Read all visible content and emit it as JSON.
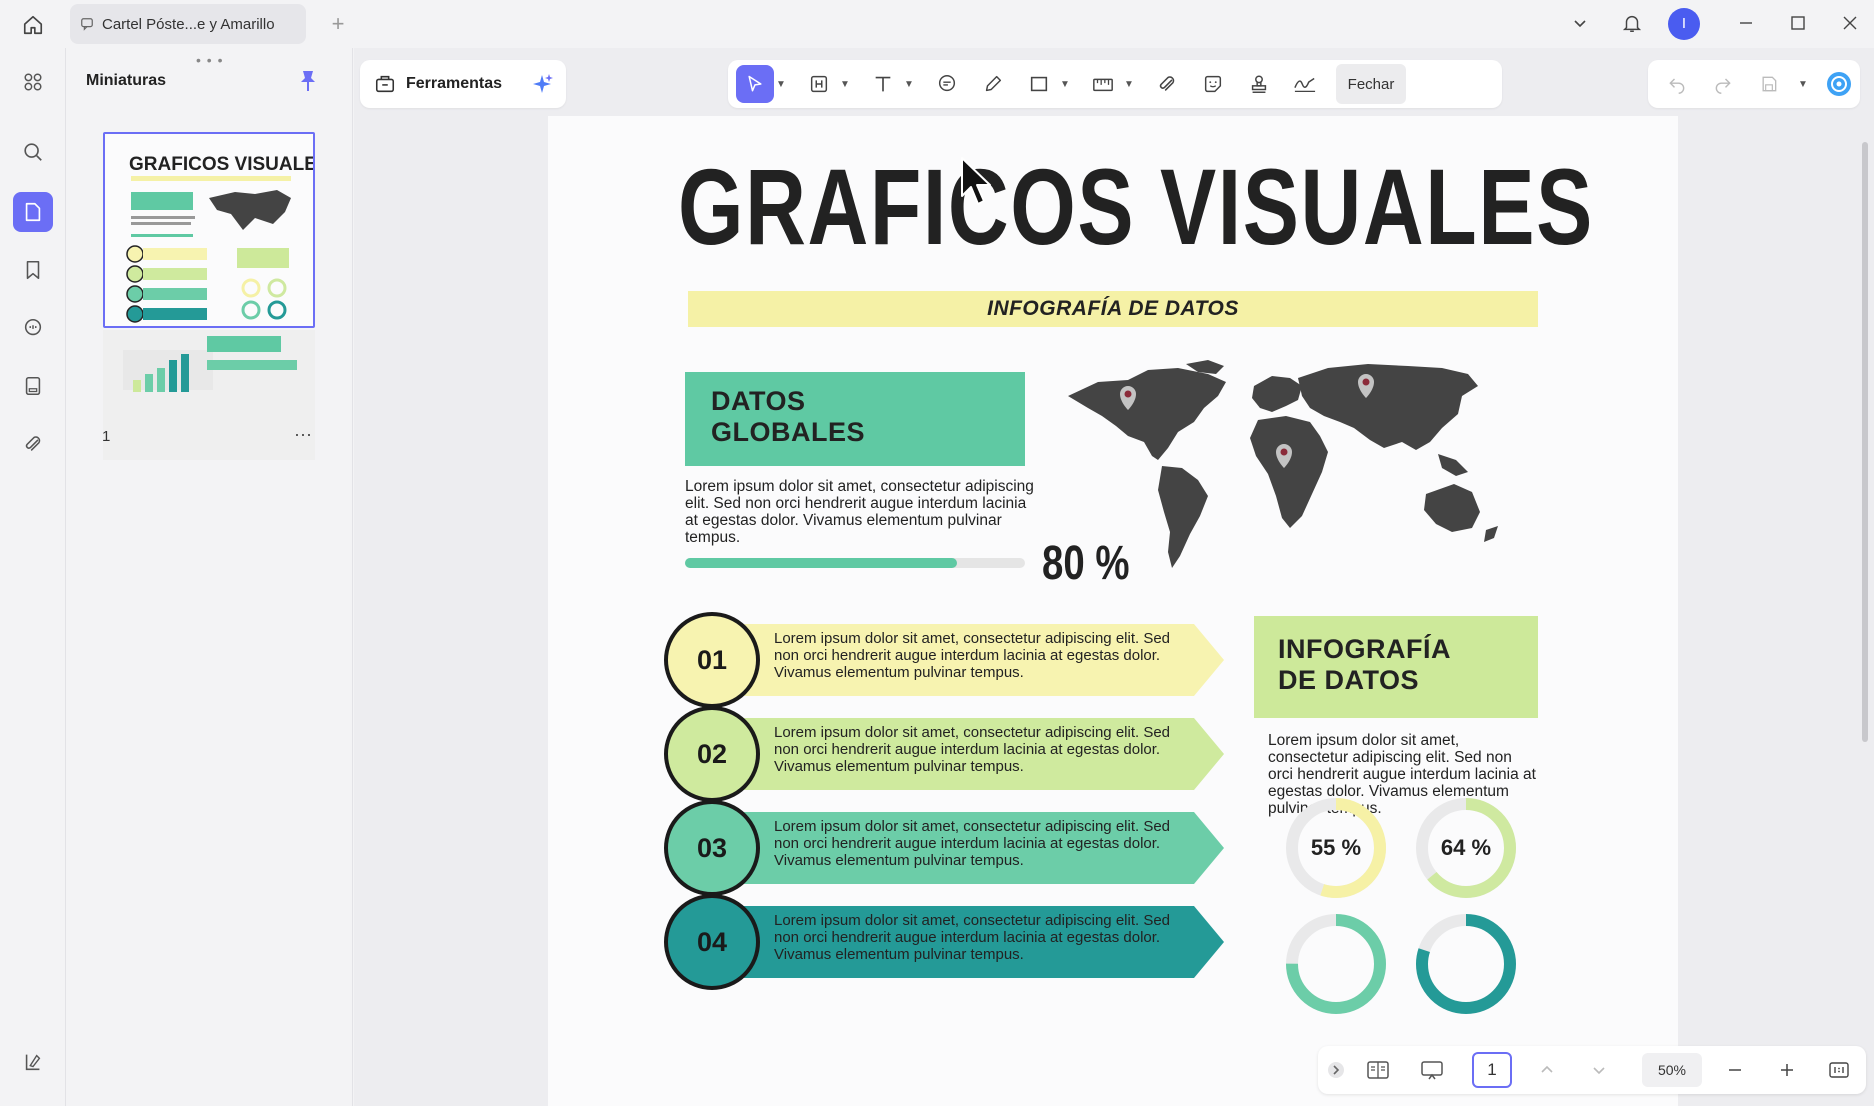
{
  "app": {
    "tab_title": "Cartel Póste...e y Amarillo",
    "avatar_initial": "I"
  },
  "sidebar": {
    "panel_title": "Miniaturas",
    "page_number": "1",
    "more": "···"
  },
  "toolbar": {
    "tools_label": "Ferramentas",
    "close_label": "Fechar"
  },
  "document": {
    "title": "GRAFICOS VISUALES",
    "subtitle": "INFOGRAFÍA DE DATOS",
    "global": {
      "heading_line1": "DATOS",
      "heading_line2": "GLOBALES",
      "body": "Lorem ipsum dolor sit amet, consectetur adipiscing elit. Sed non orci hendrerit augue interdum lacinia at egestas dolor. Vivamus elementum pulvinar tempus.",
      "percent_label": "80 %",
      "progress": 0.8
    },
    "steps": [
      {
        "num": "01",
        "text": "Lorem ipsum dolor sit amet, consectetur adipiscing elit. Sed non orci hendrerit augue interdum lacinia at egestas dolor. Vivamus elementum pulvinar tempus.",
        "color": "#f7f3b0"
      },
      {
        "num": "02",
        "text": "Lorem ipsum dolor sit amet, consectetur adipiscing elit. Sed non orci hendrerit augue interdum lacinia at egestas dolor. Vivamus elementum pulvinar tempus.",
        "color": "#cfea9e"
      },
      {
        "num": "03",
        "text": "Lorem ipsum dolor sit amet, consectetur adipiscing elit. Sed non orci hendrerit augue interdum lacinia at egestas dolor. Vivamus elementum pulvinar tempus.",
        "color": "#6ccda8"
      },
      {
        "num": "04",
        "text": "Lorem ipsum dolor sit amet, consectetur adipiscing elit. Sed non orci hendrerit augue interdum lacinia at egestas dolor. Vivamus elementum pulvinar tempus.",
        "color": "#249a97"
      }
    ],
    "info": {
      "heading_line1": "INFOGRAFÍA",
      "heading_line2": "DE DATOS",
      "body": "Lorem ipsum dolor sit amet, consectetur adipiscing elit. Sed non orci hendrerit augue interdum lacinia at egestas dolor. Vivamus elementum pulvinar tempus."
    },
    "donuts": [
      {
        "label": "55 %",
        "value": 0.55,
        "color": "#f6f1a6"
      },
      {
        "label": "64 %",
        "value": 0.64,
        "color": "#cfe9a0"
      },
      {
        "label": "",
        "value": 0.75,
        "color": "#6ccda8"
      },
      {
        "label": "",
        "value": 0.8,
        "color": "#249a97"
      }
    ]
  },
  "nav": {
    "current_page": "1",
    "zoom": "50%"
  },
  "colors": {
    "accent": "#6b6ef5",
    "teal": "#5fc9a3",
    "yellow": "#f5f1a6"
  }
}
